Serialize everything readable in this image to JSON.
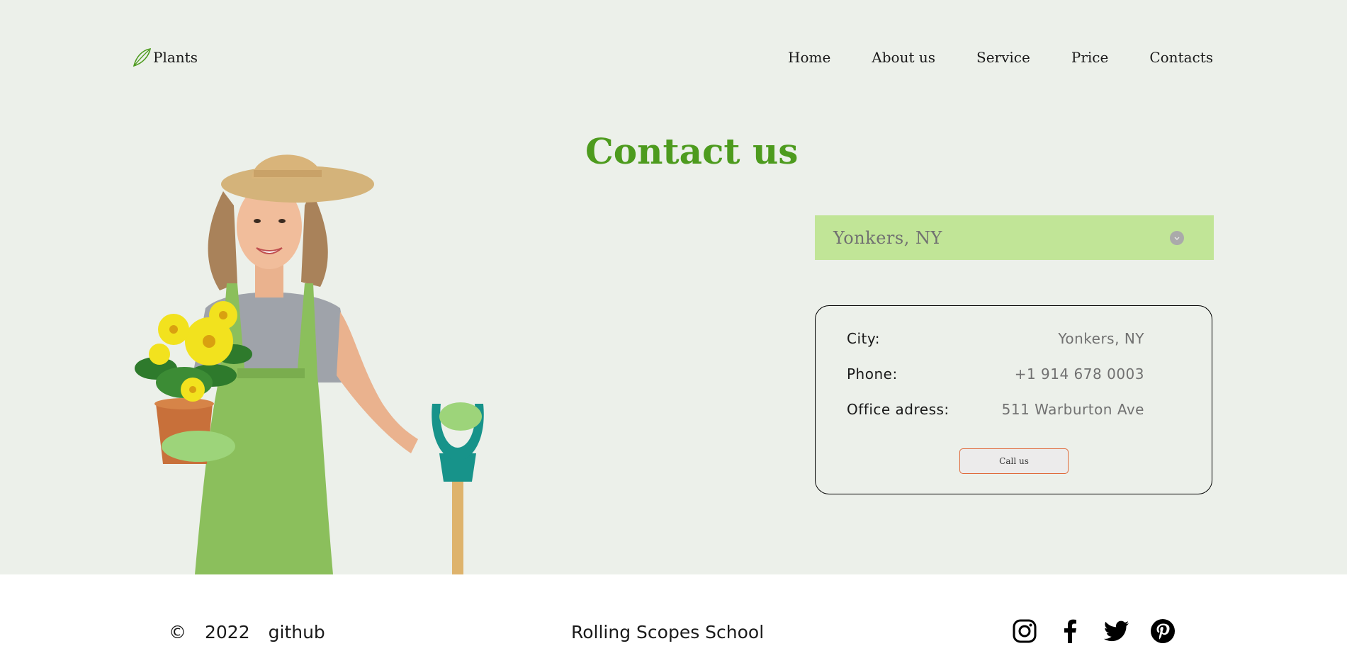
{
  "header": {
    "logo_text": "Plants",
    "nav": [
      "Home",
      "About us",
      "Service",
      "Price",
      "Contacts"
    ]
  },
  "main": {
    "title": "Contact us",
    "city_select": {
      "value": "Yonkers, NY"
    },
    "contact_card": {
      "rows": [
        {
          "label": "City:",
          "value": "Yonkers, NY"
        },
        {
          "label": "Phone:",
          "value": "+1 914 678 0003"
        },
        {
          "label": "Office adress:",
          "value": "511 Warburton Ave"
        }
      ],
      "call_button": "Call us"
    }
  },
  "footer": {
    "copyright": "©",
    "year": "2022",
    "github": "github",
    "school": "Rolling Scopes School",
    "socials": [
      "instagram-icon",
      "facebook-icon",
      "twitter-icon",
      "pinterest-icon"
    ]
  },
  "colors": {
    "background": "#ecf0ea",
    "accent_green": "#4d9b1e",
    "select_bg": "#c1e597",
    "button_border": "#e06b3c"
  }
}
